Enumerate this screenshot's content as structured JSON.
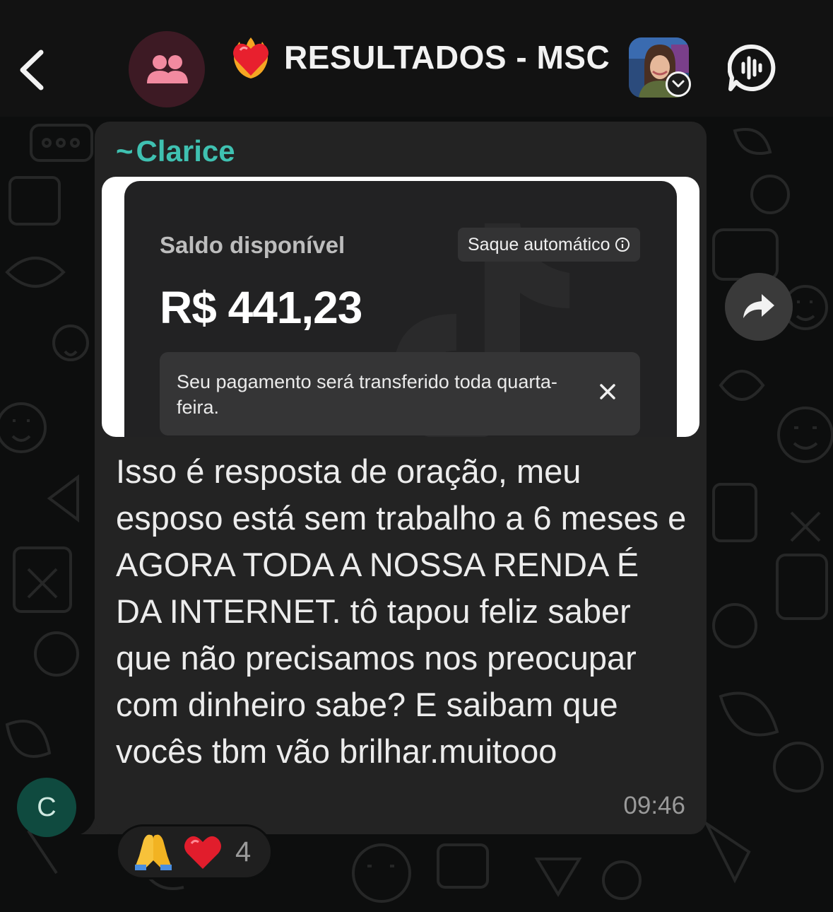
{
  "header": {
    "title": "RESULTADOS - MSC"
  },
  "message": {
    "sender_tilde": "~",
    "sender": "Clarice",
    "media": {
      "saldo_label": "Saldo disponível",
      "saque_label": "Saque automático",
      "amount": "R$ 441,23",
      "notice": "Seu pagamento será transferido toda quarta-feira."
    },
    "text": "Isso é resposta de oração,  meu esposo está sem trabalho a 6 meses e AGORA TODA A NOSSA RENDA É DA INTERNET.  tô tapou feliz saber que não precisamos nos preocupar com dinheiro sabe? E saibam que vocês tbm vão brilhar.muitooo",
    "time": "09:46",
    "avatar_initial": "C"
  },
  "reactions": {
    "emojis": [
      "folded-hands",
      "red-heart"
    ],
    "count": "4"
  },
  "colors": {
    "header_bg": "#121212",
    "bubble_bg": "#232323",
    "sender_name": "#3fc1b1",
    "group_avatar_bg": "#3d1a24",
    "group_avatar_icon": "#f28aa0"
  }
}
